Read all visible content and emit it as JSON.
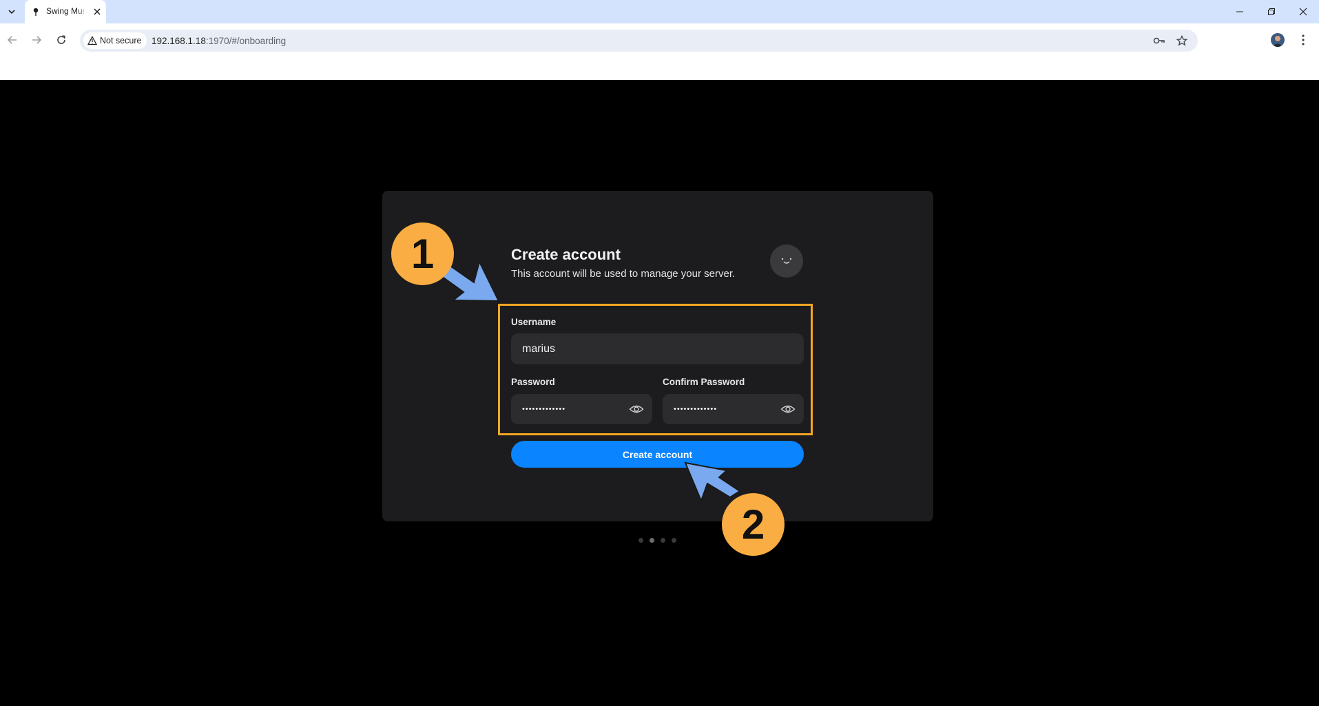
{
  "browser": {
    "tab_title": "Swing Music",
    "security_label": "Not secure",
    "url_host": "192.168.1.18",
    "url_rest": ":1970/#/onboarding"
  },
  "page": {
    "title": "Create account",
    "subtitle": "This account will be used to manage your server.",
    "username_label": "Username",
    "username_value": "marius",
    "password_label": "Password",
    "password_value": "•••••••••••••",
    "confirm_label": "Confirm Password",
    "confirm_value": "•••••••••••••",
    "submit_label": "Create account",
    "steps_total": 4,
    "steps_current": 2
  },
  "annotations": {
    "marker_1": "1",
    "marker_2": "2",
    "highlight_color": "#f5a623",
    "arrow_color": "#7aa9ef"
  },
  "colors": {
    "accent": "#0a84ff",
    "card": "#1c1c1e",
    "marker": "#f9ad42"
  }
}
